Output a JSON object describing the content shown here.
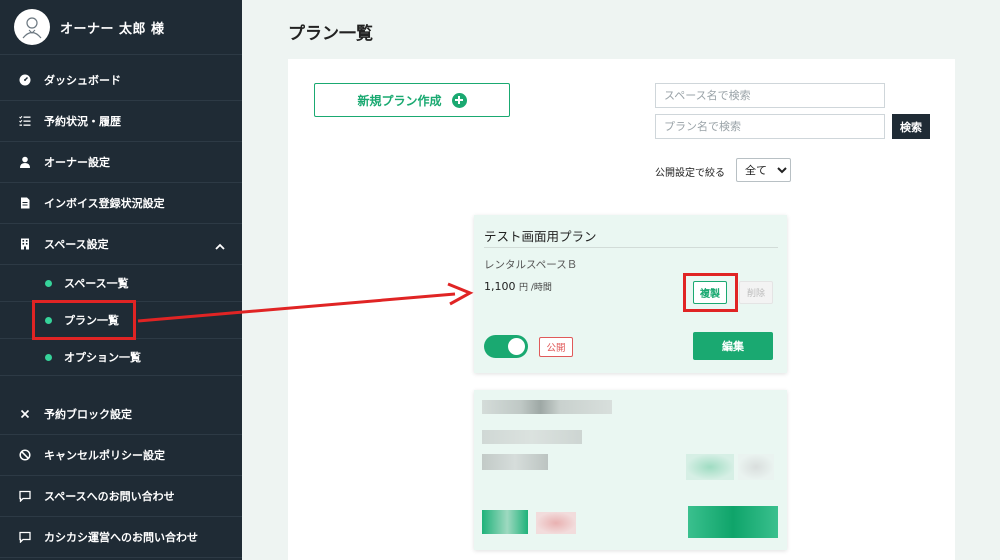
{
  "user": {
    "name": "オーナー 太郎 様"
  },
  "sidebar": {
    "items": [
      {
        "label": "ダッシュボード",
        "icon": "dashboard-icon"
      },
      {
        "label": "予約状況・履歴",
        "icon": "list-icon"
      },
      {
        "label": "オーナー設定",
        "icon": "user-icon"
      },
      {
        "label": "インボイス登録状況設定",
        "icon": "document-icon"
      },
      {
        "label": "スペース設定",
        "icon": "building-icon"
      }
    ],
    "sub_items": [
      {
        "label": "スペース一覧"
      },
      {
        "label": "プラン一覧"
      },
      {
        "label": "オプション一覧"
      }
    ],
    "bottom_items": [
      {
        "label": "予約ブロック設定",
        "icon": "x-icon"
      },
      {
        "label": "キャンセルポリシー設定",
        "icon": "ban-icon"
      },
      {
        "label": "スペースへのお問い合わせ",
        "icon": "chat-icon"
      },
      {
        "label": "カシカシ運営へのお問い合わせ",
        "icon": "chat-icon"
      }
    ]
  },
  "main": {
    "title": "プラン一覧",
    "new_plan_label": "新規プラン作成",
    "search_space_placeholder": "スペース名で検索",
    "search_plan_placeholder": "プラン名で検索",
    "search_button": "検索",
    "filter_label": "公開設定で絞る",
    "filter_value": "全て"
  },
  "plan_card": {
    "title": "テスト画面用プラン",
    "space": "レンタルスペースＢ",
    "price": "1,100",
    "price_unit": "円 /時間",
    "duplicate_label": "複製",
    "delete_label": "削除",
    "toggle_on": true,
    "public_label": "公開",
    "edit_label": "編集"
  },
  "colors": {
    "sidebar_bg": "#1f2b35",
    "accent": "#1aa971",
    "highlight": "#e02424"
  }
}
